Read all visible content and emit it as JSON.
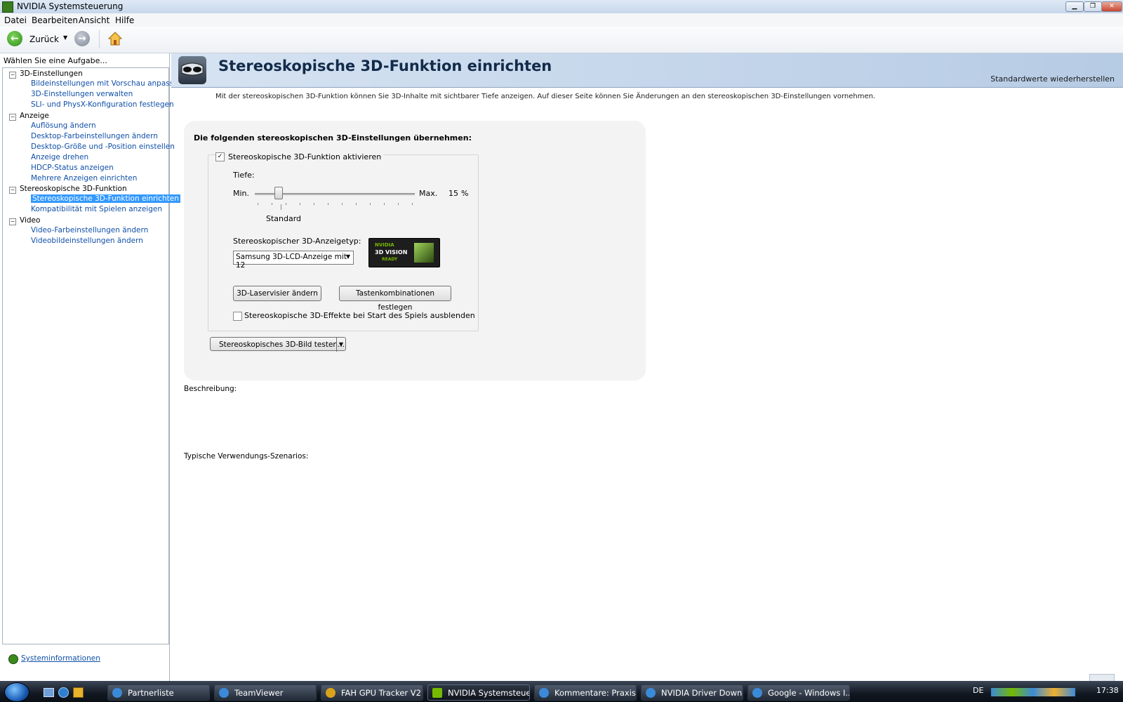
{
  "window": {
    "title": "NVIDIA Systemsteuerung",
    "min_label": "▁",
    "max_label": "❐",
    "close_label": "✕"
  },
  "menu": [
    "Datei",
    "Bearbeiten",
    "Ansicht",
    "Hilfe"
  ],
  "toolbar": {
    "back_label": "Zurück",
    "back_icon": "arrow-left-icon",
    "forward_icon": "arrow-right-icon",
    "home_icon": "home-icon"
  },
  "sidebar": {
    "prompt": "Wählen Sie eine Aufgabe...",
    "groups": [
      {
        "label": "3D-Einstellungen",
        "items": [
          "Bildeinstellungen mit Vorschau anpassen",
          "3D-Einstellungen verwalten",
          "SLI- und PhysX-Konfiguration festlegen"
        ]
      },
      {
        "label": "Anzeige",
        "items": [
          "Auflösung ändern",
          "Desktop-Farbeinstellungen ändern",
          "Desktop-Größe und -Position einstellen",
          "Anzeige drehen",
          "HDCP-Status anzeigen",
          "Mehrere Anzeigen einrichten"
        ]
      },
      {
        "label": "Stereoskopische 3D-Funktion",
        "items": [
          "Stereoskopische 3D-Funktion einrichten",
          "Kompatibilität mit Spielen anzeigen"
        ]
      },
      {
        "label": "Video",
        "items": [
          "Video-Farbeinstellungen ändern",
          "Videobildeinstellungen ändern"
        ]
      }
    ],
    "selected_item": "Stereoskopische 3D-Funktion einrichten",
    "expander_symbol": "−",
    "system_info": "Systeminformationen"
  },
  "page": {
    "title": "Stereoskopische 3D-Funktion einrichten",
    "restore_defaults": "Standardwerte wiederherstellen",
    "intro": "Mit der stereoskopischen 3D-Funktion können Sie 3D-Inhalte mit sichtbarer Tiefe anzeigen. Auf dieser Seite können Sie Änderungen an den stereoskopischen 3D-Einstellungen vornehmen.",
    "panel_heading": "Die folgenden stereoskopischen 3D-Einstellungen übernehmen:",
    "enable_checkbox": {
      "label": "Stereoskopische 3D-Funktion aktivieren",
      "checked": true,
      "mark": "✓"
    },
    "depth": {
      "label": "Tiefe:",
      "min_label": "Min.",
      "max_label": "Max.",
      "value": "15",
      "unit": "%",
      "default_label": "Standard",
      "slider_fraction": 0.15
    },
    "display_type_label": "Stereoskopischer 3D-Anzeigetyp:",
    "display_type_value": "Samsung 3D-LCD-Anzeige mit 12",
    "dropdown_arrow": "▼",
    "logo": {
      "brand": "NVIDIA",
      "line1": "3D VISION",
      "line2": "READY"
    },
    "laser_button": "3D-Laservisier ändern",
    "hotkeys_button": "Tastenkombinationen festlegen",
    "hide_effects_checkbox": {
      "label": "Stereoskopische 3D-Effekte bei Start des Spiels ausblenden",
      "checked": false
    },
    "test_button": "Stereoskopisches 3D-Bild testen...",
    "description_label": "Beschreibung:",
    "scenarios_label": "Typische Verwendungs-Szenarios:"
  },
  "taskbar": {
    "buttons": [
      "Partnerliste",
      "TeamViewer",
      "FAH GPU Tracker V2",
      "NVIDIA Systemsteue...",
      "Kommentare: Praxis...",
      "NVIDIA Driver Down...",
      "Google - Windows I..."
    ],
    "active": "NVIDIA Systemsteue...",
    "language": "DE",
    "clock": "17:38"
  }
}
